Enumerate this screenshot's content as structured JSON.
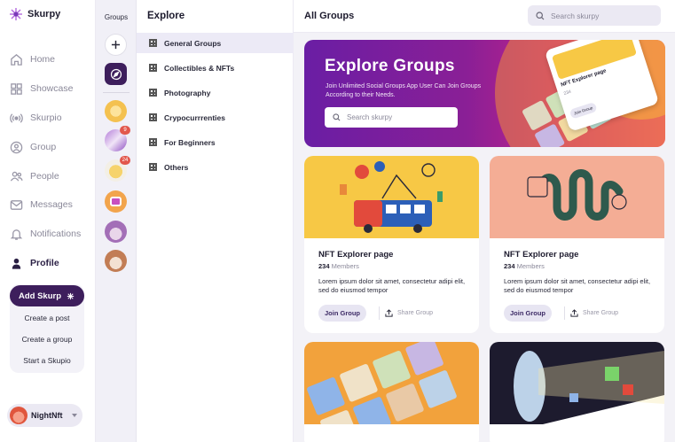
{
  "brand": {
    "name": "Skurpy"
  },
  "nav": {
    "items": [
      {
        "label": "Home",
        "icon": "home-icon"
      },
      {
        "label": "Showcase",
        "icon": "showcase-icon"
      },
      {
        "label": "Skurpio",
        "icon": "broadcast-icon"
      },
      {
        "label": "Group",
        "icon": "group-icon"
      },
      {
        "label": "People",
        "icon": "people-icon"
      },
      {
        "label": "Messages",
        "icon": "mail-icon"
      },
      {
        "label": "Notifications",
        "icon": "bell-icon"
      },
      {
        "label": "Profile",
        "icon": "profile-icon"
      }
    ],
    "add_label": "Add Skurp",
    "submenu": [
      "Create a post",
      "Create a group",
      "Start a Skupio"
    ]
  },
  "user": {
    "name": "NightNft"
  },
  "rail": {
    "title": "Groups",
    "badges": [
      "9",
      "24"
    ]
  },
  "explore": {
    "title": "Explore",
    "categories": [
      "General Groups",
      "Collectibles & NFTs",
      "Photography",
      "Crypocurrrenties",
      "For Beginners",
      "Others"
    ]
  },
  "main": {
    "title": "All Groups",
    "search_placeholder": "Search skurpy"
  },
  "hero": {
    "title": "Explore Groups",
    "description": "Join Unlimited Social Groups App User Can Join Groups According to their Needs.",
    "search_placeholder": "Search skurpy",
    "mini_card_title": "NFT Explorer page",
    "mini_card_members": "234",
    "mini_card_join": "Join Group"
  },
  "cards": [
    {
      "title": "NFT Explorer page",
      "members_count": "234",
      "members_label": "Members",
      "description": "Lorem ipsum dolor sit amet, consectetur adipi elit, sed do eiusmod tempor",
      "join": "Join Group",
      "share": "Share Group"
    },
    {
      "title": "NFT Explorer page",
      "members_count": "234",
      "members_label": "Members",
      "description": "Lorem ipsum dolor sit amet, consectetur adipi elit, sed do eiusmod tempor",
      "join": "Join Group",
      "share": "Share Group"
    }
  ],
  "colors": {
    "accent": "#3d1e5c",
    "hero_start": "#6a1ea4",
    "hero_end": "#e64a7a",
    "card1_bg": "#f7c845",
    "card2_bg": "#f4ad95"
  }
}
